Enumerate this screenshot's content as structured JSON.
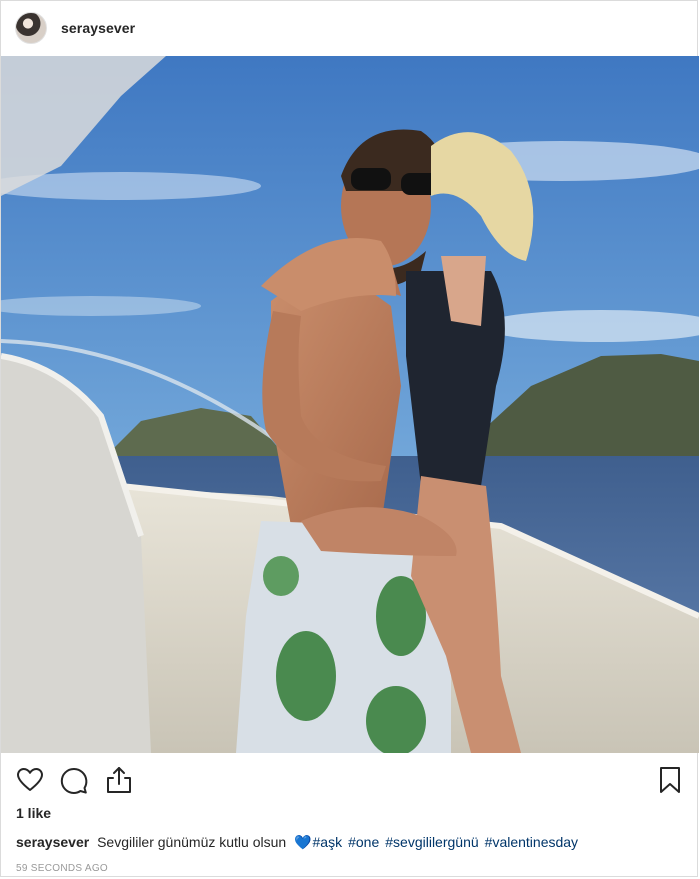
{
  "post": {
    "username": "seraysever",
    "likes_text": "1 like",
    "caption": {
      "username": "seraysever",
      "text": "Sevgililer günümüz kutlu olsun",
      "emoji": "💙",
      "hashtags": [
        "#aşk",
        "#one",
        "#sevgililergünü",
        "#valentinesday"
      ]
    },
    "timestamp": "59 SECONDS AGO"
  },
  "icons": {
    "avatar": "profile-avatar",
    "like": "heart-outline-icon",
    "comment": "comment-bubble-icon",
    "share": "share-arrow-icon",
    "save": "bookmark-icon"
  },
  "colors": {
    "text": "#262626",
    "hashtag": "#003569",
    "heart_emoji": "#3897f0",
    "timestamp": "#999999",
    "border": "#dbdbdb"
  }
}
